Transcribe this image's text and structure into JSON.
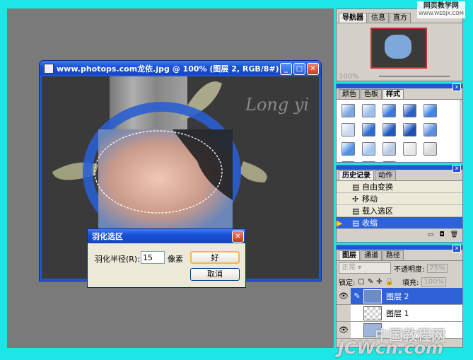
{
  "watermark_top": "网页教学网",
  "watermark_top_url": "WWW.WEBJX.COM",
  "watermark_bottom_cn": "中国教程网",
  "watermark_bottom_en": "JCWcn.com",
  "document": {
    "title": "www.photops.com龙依.jpg @ 100% (图层 2, RGB/8#)",
    "signature": "Long yi"
  },
  "navigator": {
    "tabs": [
      "导航器",
      "信息",
      "直方"
    ],
    "zoom": "100%"
  },
  "styles_panel": {
    "tabs": [
      "颜色",
      "色板",
      "样式"
    ],
    "swatch_colors": [
      "#7da7e0",
      "#9fc0ea",
      "#3c78d8",
      "#2a62c4",
      "#3f86e6",
      "#c9d9ef",
      "#2e6ad0",
      "#1f58c0",
      "#1b4fb4",
      "#5b8de0",
      "#4f90e8",
      "#a8c6ee",
      "#b8c8e0",
      "#e8e8e8",
      "#d8d8d8",
      "#e0e0e0",
      "#cfcfcf",
      "#dadada"
    ]
  },
  "history": {
    "tabs": [
      "历史记录",
      "动作"
    ],
    "items": [
      {
        "label": "自由变换",
        "selected": false
      },
      {
        "label": "移动",
        "selected": false
      },
      {
        "label": "载入选区",
        "selected": false
      },
      {
        "label": "收缩",
        "selected": true
      }
    ]
  },
  "layers": {
    "tabs": [
      "图层",
      "通道",
      "路径"
    ],
    "blend_mode": "正常",
    "opacity_label": "不透明度:",
    "opacity_value": "75%",
    "lock_label": "锁定:",
    "fill_label": "填充:",
    "fill_value": "100%",
    "items": [
      {
        "name": "图层 2",
        "selected": true
      },
      {
        "name": "图层 1",
        "selected": false
      },
      {
        "name": "",
        "selected": false
      }
    ]
  },
  "feather_dialog": {
    "title": "羽化选区",
    "radius_label": "羽化半径(R):",
    "radius_value": "15",
    "unit": "像素",
    "ok_label": "好",
    "cancel_label": "取消"
  }
}
